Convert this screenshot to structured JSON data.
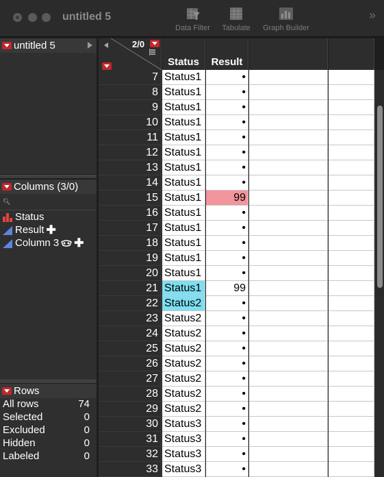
{
  "window": {
    "title": "untitled 5"
  },
  "toolbar": {
    "data_filter": "Data Filter",
    "tabulate": "Tabulate",
    "graph_builder": "Graph Builder",
    "overflow": "»"
  },
  "table_panel": {
    "name": "untitled 5"
  },
  "columns_panel": {
    "title": "Columns (3/0)",
    "items": [
      {
        "name": "Status",
        "icon": "nominal-bar-icon"
      },
      {
        "name": "Result",
        "icon": "continuous-icon"
      },
      {
        "name": "Column 3",
        "icon": "continuous-icon"
      }
    ]
  },
  "rows_panel": {
    "title": "Rows",
    "stats": [
      {
        "label": "All rows",
        "value": "74"
      },
      {
        "label": "Selected",
        "value": "0"
      },
      {
        "label": "Excluded",
        "value": "0"
      },
      {
        "label": "Hidden",
        "value": "0"
      },
      {
        "label": "Labeled",
        "value": "0"
      }
    ]
  },
  "grid": {
    "corner_count": "2/0",
    "headers": [
      "Status",
      "Result"
    ],
    "rows": [
      {
        "n": "7",
        "status": "Status1",
        "result": "•"
      },
      {
        "n": "8",
        "status": "Status1",
        "result": "•"
      },
      {
        "n": "9",
        "status": "Status1",
        "result": "•"
      },
      {
        "n": "10",
        "status": "Status1",
        "result": "•"
      },
      {
        "n": "11",
        "status": "Status1",
        "result": "•"
      },
      {
        "n": "12",
        "status": "Status1",
        "result": "•"
      },
      {
        "n": "13",
        "status": "Status1",
        "result": "•"
      },
      {
        "n": "14",
        "status": "Status1",
        "result": "•"
      },
      {
        "n": "15",
        "status": "Status1",
        "result": "99",
        "result_highlight": true
      },
      {
        "n": "16",
        "status": "Status1",
        "result": "•"
      },
      {
        "n": "17",
        "status": "Status1",
        "result": "•"
      },
      {
        "n": "18",
        "status": "Status1",
        "result": "•"
      },
      {
        "n": "19",
        "status": "Status1",
        "result": "•"
      },
      {
        "n": "20",
        "status": "Status1",
        "result": "•"
      },
      {
        "n": "21",
        "status": "Status1",
        "result": "99",
        "status_selected": true
      },
      {
        "n": "22",
        "status": "Status2",
        "result": "•",
        "status_selected": true
      },
      {
        "n": "23",
        "status": "Status2",
        "result": "•"
      },
      {
        "n": "24",
        "status": "Status2",
        "result": "•"
      },
      {
        "n": "25",
        "status": "Status2",
        "result": "•"
      },
      {
        "n": "26",
        "status": "Status2",
        "result": "•"
      },
      {
        "n": "27",
        "status": "Status2",
        "result": "•"
      },
      {
        "n": "28",
        "status": "Status2",
        "result": "•"
      },
      {
        "n": "29",
        "status": "Status2",
        "result": "•"
      },
      {
        "n": "30",
        "status": "Status3",
        "result": "•"
      },
      {
        "n": "31",
        "status": "Status3",
        "result": "•"
      },
      {
        "n": "32",
        "status": "Status3",
        "result": "•"
      },
      {
        "n": "33",
        "status": "Status3",
        "result": "•"
      }
    ]
  },
  "colors": {
    "highlight_cell": "#f2949c",
    "selected_cell": "#7fdff1",
    "red_button": "#c0272d"
  }
}
